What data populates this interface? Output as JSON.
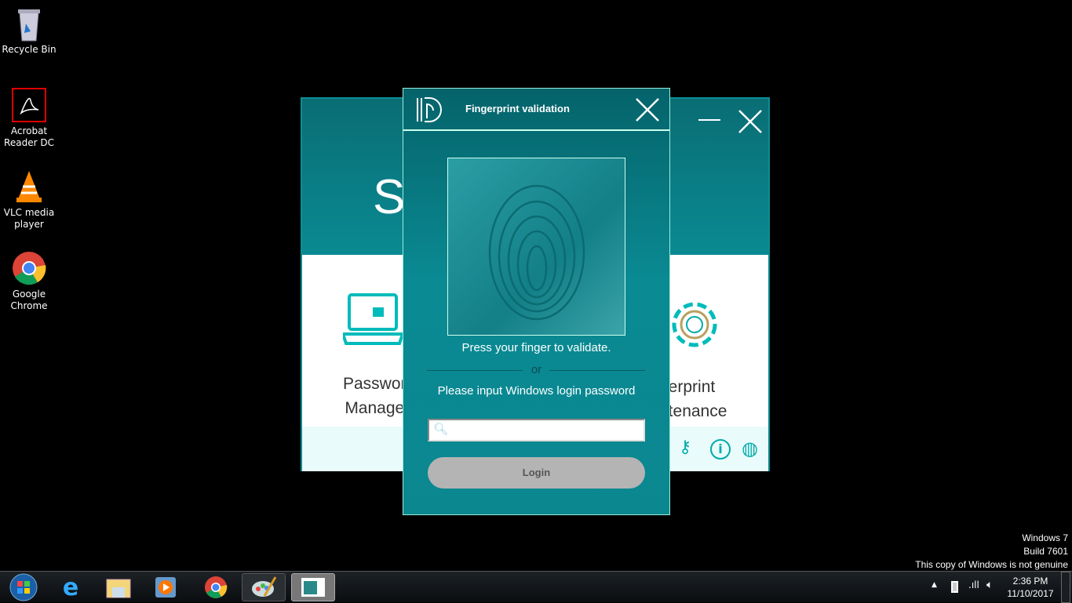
{
  "desktop": {
    "icons": [
      {
        "label": "Recycle Bin"
      },
      {
        "label": "Acrobat Reader DC"
      },
      {
        "label": "VLC media player"
      },
      {
        "label": "Google Chrome"
      }
    ]
  },
  "main_window": {
    "title_partial": "S",
    "features": [
      {
        "label_line1": "Passwor",
        "label_line2": "Manage"
      },
      {
        "label_line1": "gerprint",
        "label_line2": "ntenance"
      }
    ],
    "accent": "#0a8a92"
  },
  "dialog": {
    "title": "Fingerprint validation",
    "instruction": "Press your finger to validate.",
    "or": "or",
    "password_prompt": "Please input Windows login password",
    "password_value": "",
    "login_label": "Login"
  },
  "watermark": {
    "line1": "Windows 7",
    "line2": "Build 7601",
    "line3": "This copy of Windows is not genuine"
  },
  "taskbar": {
    "time": "2:36 PM",
    "date": "11/10/2017",
    "pinned": [
      "start-orb",
      "internet-explorer",
      "windows-explorer",
      "media-player",
      "google-chrome",
      "paint",
      "active-window"
    ]
  }
}
